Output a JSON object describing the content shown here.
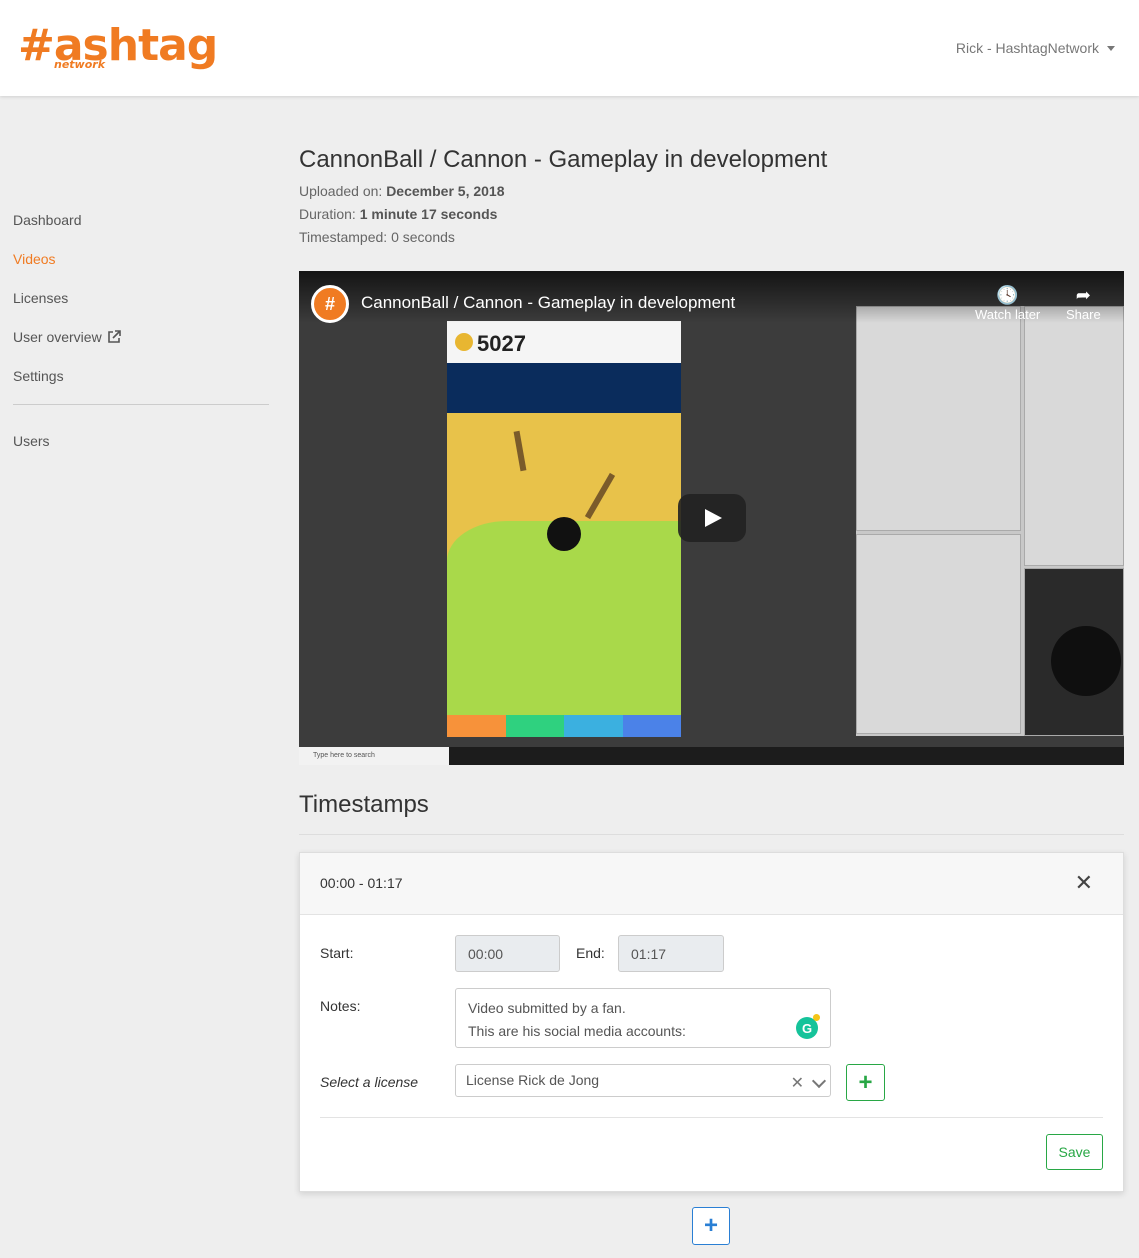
{
  "brand": {
    "logo_main": "#ashtag",
    "logo_sub": "network",
    "accent": "#f07b22"
  },
  "header": {
    "user_menu": "Rick - HashtagNetwork",
    "user_menu_icon": "caret-down-icon"
  },
  "sidebar": {
    "items": [
      {
        "label": "Dashboard",
        "active": false
      },
      {
        "label": "Videos",
        "active": true
      },
      {
        "label": "Licenses",
        "active": false
      },
      {
        "label": "User overview",
        "active": false,
        "icon": "external-link-icon"
      },
      {
        "label": "Settings",
        "active": false
      }
    ],
    "secondary": [
      {
        "label": "Users"
      }
    ]
  },
  "video": {
    "title": "CannonBall / Cannon - Gameplay in development",
    "uploaded_label": "Uploaded on:",
    "uploaded_value": "December 5, 2018",
    "duration_label": "Duration:",
    "duration_value": "1 minute 17 seconds",
    "timestamped_label": "Timestamped:",
    "timestamped_value": "0 seconds",
    "player": {
      "title": "CannonBall / Cannon - Gameplay in development",
      "watch_later": "Watch later",
      "share": "Share",
      "score": "5027",
      "taskbar_search": "Type here to search",
      "channel_glyph": "#"
    }
  },
  "timestamps": {
    "heading": "Timestamps",
    "items": [
      {
        "range": "00:00 - 01:17",
        "start_label": "Start:",
        "start_value": "00:00",
        "end_label": "End:",
        "end_value": "01:17",
        "notes_label": "Notes:",
        "notes_line1": "Video submitted by a fan.",
        "notes_line2": "This are his social media accounts:",
        "license_label": "Select a license",
        "license_value": "License Rick de Jong",
        "save_label": "Save"
      }
    ],
    "add_label": "+",
    "add_license_label": "+"
  },
  "colors": {
    "success": "#28a745",
    "primary": "#2a7fd4",
    "game_bar": [
      "#f7923a",
      "#2fd17f",
      "#3bb0e0",
      "#4b82e8"
    ]
  }
}
